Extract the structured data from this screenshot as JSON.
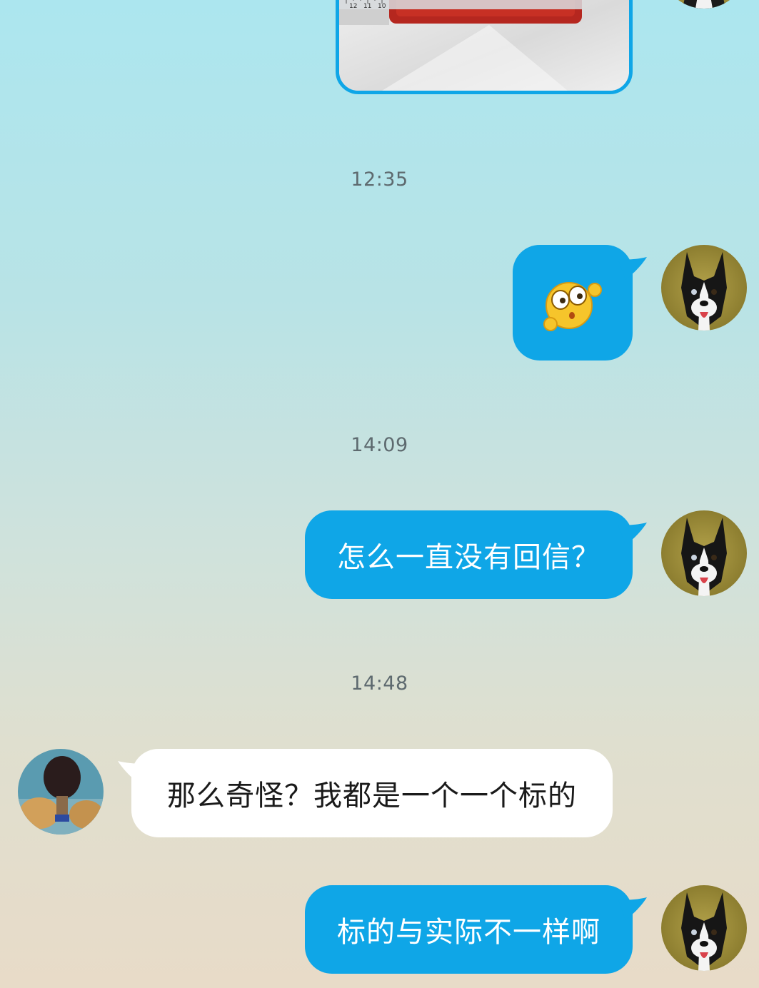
{
  "timestamps": {
    "t1": "12:35",
    "t2": "14:09",
    "t3": "14:48"
  },
  "messages": [
    {
      "side": "out",
      "type": "image",
      "content_desc": "photo-of-ruler-and-red-object",
      "ruler_marks": [
        "12",
        "11",
        "10"
      ]
    },
    {
      "side": "out",
      "type": "emoji",
      "emoji": "shocked-face-emoji"
    },
    {
      "side": "out",
      "type": "text",
      "text": "怎么一直没有回信？"
    },
    {
      "side": "in",
      "type": "text",
      "text": "那么奇怪？我都是一个一个标的"
    },
    {
      "side": "out",
      "type": "text",
      "text": "标的与实际不一样啊"
    }
  ],
  "colors": {
    "outgoing_bubble": "#0fa6e7",
    "incoming_bubble": "#ffffff",
    "timestamp_text": "#5e6a6f"
  },
  "avatars": {
    "self": "dog-avatar",
    "other": "table-tennis-paddle-avatar"
  }
}
